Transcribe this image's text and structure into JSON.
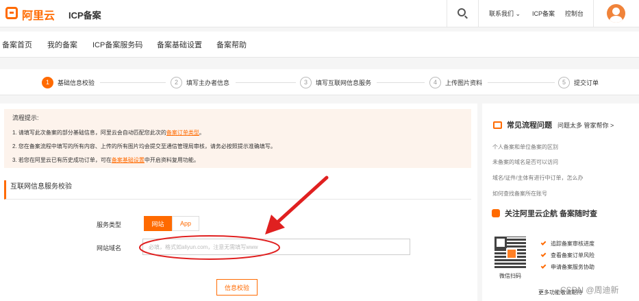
{
  "header": {
    "brand": "阿里云",
    "product": "ICP备案",
    "links": [
      "联系我们",
      "ICP备案",
      "控制台"
    ]
  },
  "nav": {
    "items": [
      "备案首页",
      "我的备案",
      "ICP备案服务码",
      "备案基础设置",
      "备案帮助"
    ]
  },
  "steps": [
    {
      "num": "1",
      "label": "基础信息校验"
    },
    {
      "num": "2",
      "label": "填写主办者信息"
    },
    {
      "num": "3",
      "label": "填写互联网信息服务"
    },
    {
      "num": "4",
      "label": "上传图片资料"
    },
    {
      "num": "5",
      "label": "提交订单"
    }
  ],
  "notice": {
    "title": "流程提示:",
    "line1_pre": "1. 请填写此次备案的部分基础信息，阿里云会自动匹配您此次的",
    "line1_link": "备案订单类型",
    "line1_post": "。",
    "line2": "2. 您在备案流程中填写的所有内容、上传的所有图片均会提交至通信管理局审核，请务必按照提示准确填写。",
    "line3_pre": "3. 若您在阿里云已有历史成功订单，可在",
    "line3_link": "备案基础设置",
    "line3_post": "中开启资料复用功能。"
  },
  "form": {
    "section_title": "互联网信息服务校验",
    "service_type_label": "服务类型",
    "service_options": [
      "网站",
      "App"
    ],
    "domain_label": "网站域名",
    "domain_placeholder": "必填，格式如aliyun.com，注意无需填写www",
    "verify_button": "信息校验"
  },
  "side": {
    "title": "常见流程问题",
    "more": "问题太多 管家帮你 >",
    "faqs": [
      "个人备案和单位备案的区别",
      "未备案的域名是否可以访问",
      "域名/证件/主体有进行中订单，怎么办",
      "如何查找备案所在账号"
    ],
    "follow_title": "关注阿里云企航 备案随时查",
    "qr_caption": "微信扫码",
    "benefits": [
      "追踪备案审核进度",
      "查看备案订单风险",
      "申请备案服务协助"
    ],
    "footer": "更多功能敬请期待"
  },
  "watermark": "CSDN @周迪新",
  "colors": {
    "accent": "#ff6a00",
    "annotation": "#e02020",
    "notice_bg": "#fdf3ec"
  }
}
